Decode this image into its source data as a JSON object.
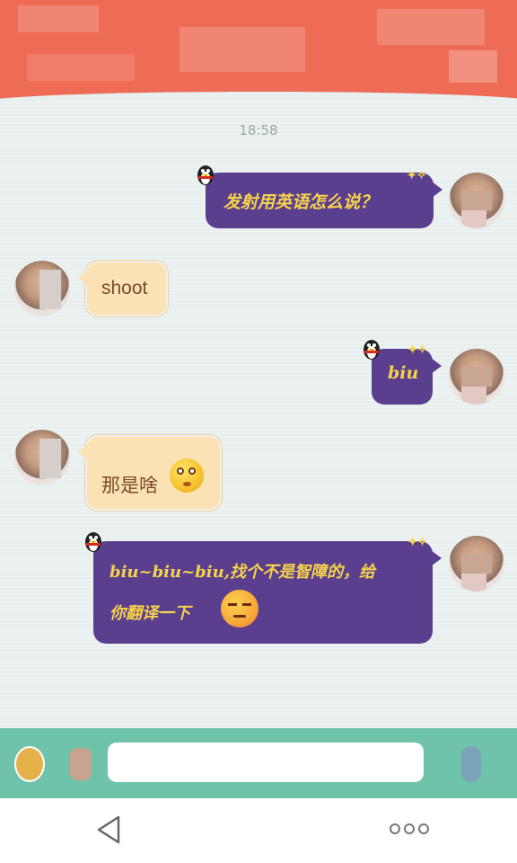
{
  "chat": {
    "timestamp": "18:58",
    "messages": [
      {
        "side": "right",
        "text": "发射用英语怎么说？"
      },
      {
        "side": "left",
        "text": "shoot"
      },
      {
        "side": "right",
        "text": "biu"
      },
      {
        "side": "left",
        "text": "那是啥",
        "emoji": "surprised-face-icon"
      },
      {
        "side": "right",
        "text_line1": "biu~biu~biu,找个不是智障的，给",
        "text_line2": "你翻译一下",
        "emoji": "unamused-face-icon"
      }
    ]
  },
  "colors": {
    "header": "#ee6b55",
    "chat_bg": "#e7f0ee",
    "purple_bubble": "#5a3f8f",
    "purple_text": "#f7d34a",
    "cream_bubble": "#fbe2b4",
    "cream_text": "#7a4a2b",
    "input_bar": "#6fc3ab"
  },
  "navbar": {
    "back_icon": "back-triangle-icon",
    "more_icon": "more-dots-icon"
  }
}
